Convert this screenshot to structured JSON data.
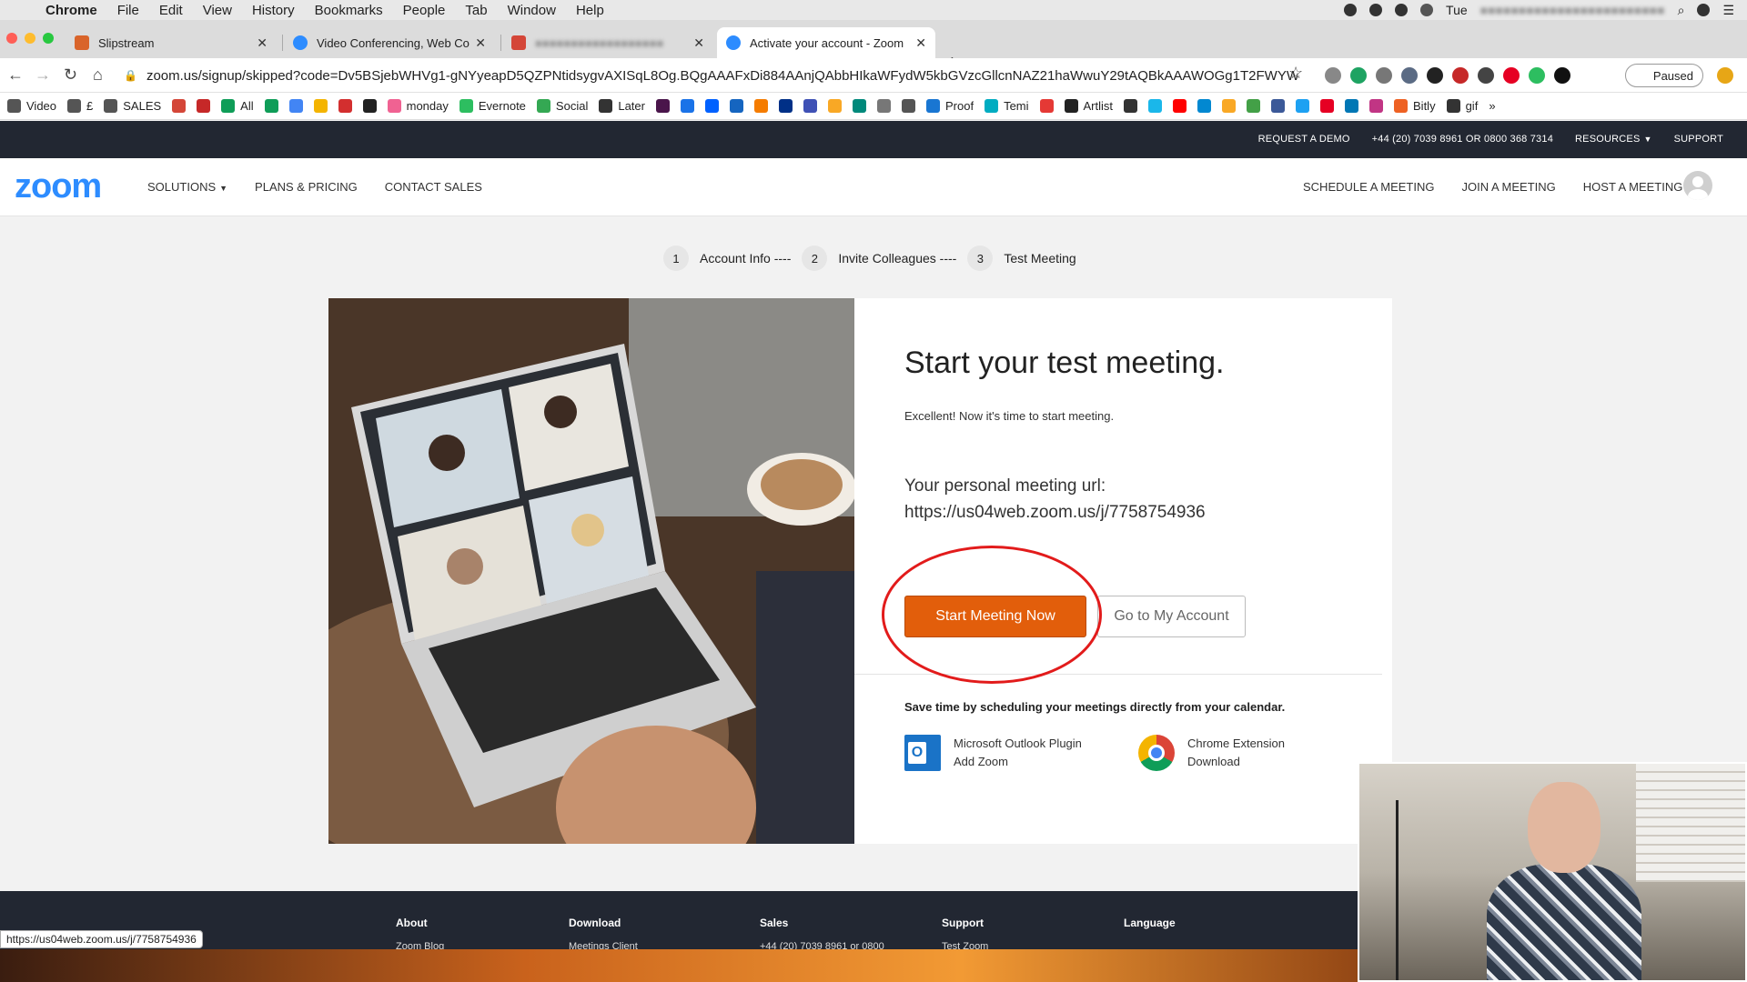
{
  "mac_menu": {
    "app": "Chrome",
    "items": [
      "File",
      "Edit",
      "View",
      "History",
      "Bookmarks",
      "People",
      "Tab",
      "Window",
      "Help"
    ],
    "clock": "Tue"
  },
  "tabs": [
    {
      "title": "Slipstream",
      "color": "#d9642a"
    },
    {
      "title": "Video Conferencing, Web Conf",
      "color": "#2d8cff"
    },
    {
      "title": "",
      "color": "#d44638"
    },
    {
      "title": "Activate your account - Zoom",
      "color": "#2d8cff",
      "active": true
    }
  ],
  "address": {
    "url": "zoom.us/signup/skipped?code=Dv5BSjebWHVg1-gNYyeapD5QZPNtidsygvAXISqL8Og.BQgAAAFxDi884AAnjQAbbHIkaWFydW5kbGVzcGllcnNAZ21haWwuY29tAQBkAAAWOGg1T2FWYW...",
    "profile_label": "Paused"
  },
  "bookmarks": [
    {
      "label": "Video",
      "color": "#555"
    },
    {
      "label": "£",
      "color": "#555"
    },
    {
      "label": "SALES",
      "color": "#555"
    },
    {
      "label": "",
      "color": "#d44638"
    },
    {
      "label": "",
      "color": "#c62828"
    },
    {
      "label": "All",
      "color": "#0f9d58"
    },
    {
      "label": "",
      "color": "#0f9d58"
    },
    {
      "label": "",
      "color": "#4285f4"
    },
    {
      "label": "",
      "color": "#f4b400"
    },
    {
      "label": "",
      "color": "#d32f2f"
    },
    {
      "label": "",
      "color": "#222"
    },
    {
      "label": "monday",
      "color": "#f06292"
    },
    {
      "label": "Evernote",
      "color": "#2dbe60"
    },
    {
      "label": "Social",
      "color": "#34a853"
    },
    {
      "label": "Later",
      "color": "#333"
    },
    {
      "label": "",
      "color": "#4a154b"
    },
    {
      "label": "",
      "color": "#1a73e8"
    },
    {
      "label": "",
      "color": "#0061ff"
    },
    {
      "label": "",
      "color": "#1565c0"
    },
    {
      "label": "",
      "color": "#f57c00"
    },
    {
      "label": "",
      "color": "#003087"
    },
    {
      "label": "",
      "color": "#3f51b5"
    },
    {
      "label": "",
      "color": "#f9a825"
    },
    {
      "label": "",
      "color": "#00897b"
    },
    {
      "label": "",
      "color": "#777"
    },
    {
      "label": "",
      "color": "#555"
    },
    {
      "label": "Proof",
      "color": "#1976d2"
    },
    {
      "label": "Temi",
      "color": "#00acc1"
    },
    {
      "label": "",
      "color": "#e53935"
    },
    {
      "label": "Artlist",
      "color": "#222"
    },
    {
      "label": "",
      "color": "#333"
    },
    {
      "label": "",
      "color": "#1ab7ea"
    },
    {
      "label": "",
      "color": "#ff0000"
    },
    {
      "label": "",
      "color": "#0288d1"
    },
    {
      "label": "",
      "color": "#f9a825"
    },
    {
      "label": "",
      "color": "#43a047"
    },
    {
      "label": "",
      "color": "#3b5998"
    },
    {
      "label": "",
      "color": "#1da1f2"
    },
    {
      "label": "",
      "color": "#e60023"
    },
    {
      "label": "",
      "color": "#0077b5"
    },
    {
      "label": "",
      "color": "#c13584"
    },
    {
      "label": "Bitly",
      "color": "#ee6123"
    },
    {
      "label": "gif",
      "color": "#333"
    }
  ],
  "zoom_topbar": [
    "REQUEST A DEMO",
    "+44 (20) 7039 8961 OR 0800 368 7314",
    "RESOURCES",
    "SUPPORT"
  ],
  "zoom_nav": {
    "logo": "zoom",
    "left": [
      "SOLUTIONS",
      "PLANS & PRICING",
      "CONTACT SALES"
    ],
    "right": [
      "SCHEDULE A MEETING",
      "JOIN A MEETING",
      "HOST A MEETING"
    ]
  },
  "steps": [
    {
      "num": "1",
      "label": "Account Info ----"
    },
    {
      "num": "2",
      "label": "Invite Colleagues ----"
    },
    {
      "num": "3",
      "label": "Test Meeting"
    }
  ],
  "main": {
    "title": "Start your test meeting.",
    "subtitle": "Excellent! Now it's time to start meeting.",
    "url_label": "Your personal meeting url:",
    "url_value": "https://us04web.zoom.us/j/7758754936",
    "start_button": "Start Meeting Now",
    "account_button": "Go to My Account",
    "calendar_hint": "Save time by scheduling your meetings directly from your calendar.",
    "outlook": {
      "line1": "Microsoft Outlook Plugin",
      "line2": "Add Zoom"
    },
    "chrome": {
      "line1": "Chrome Extension",
      "line2": "Download"
    }
  },
  "footer": {
    "columns": [
      "About",
      "Download",
      "Sales",
      "Support",
      "Language"
    ],
    "sublinks": [
      "Zoom Blog",
      "Meetings Client",
      "+44 (20) 7039 8961 or 0800",
      "Test Zoom"
    ]
  },
  "status_url": "https://us04web.zoom.us/j/7758754936"
}
